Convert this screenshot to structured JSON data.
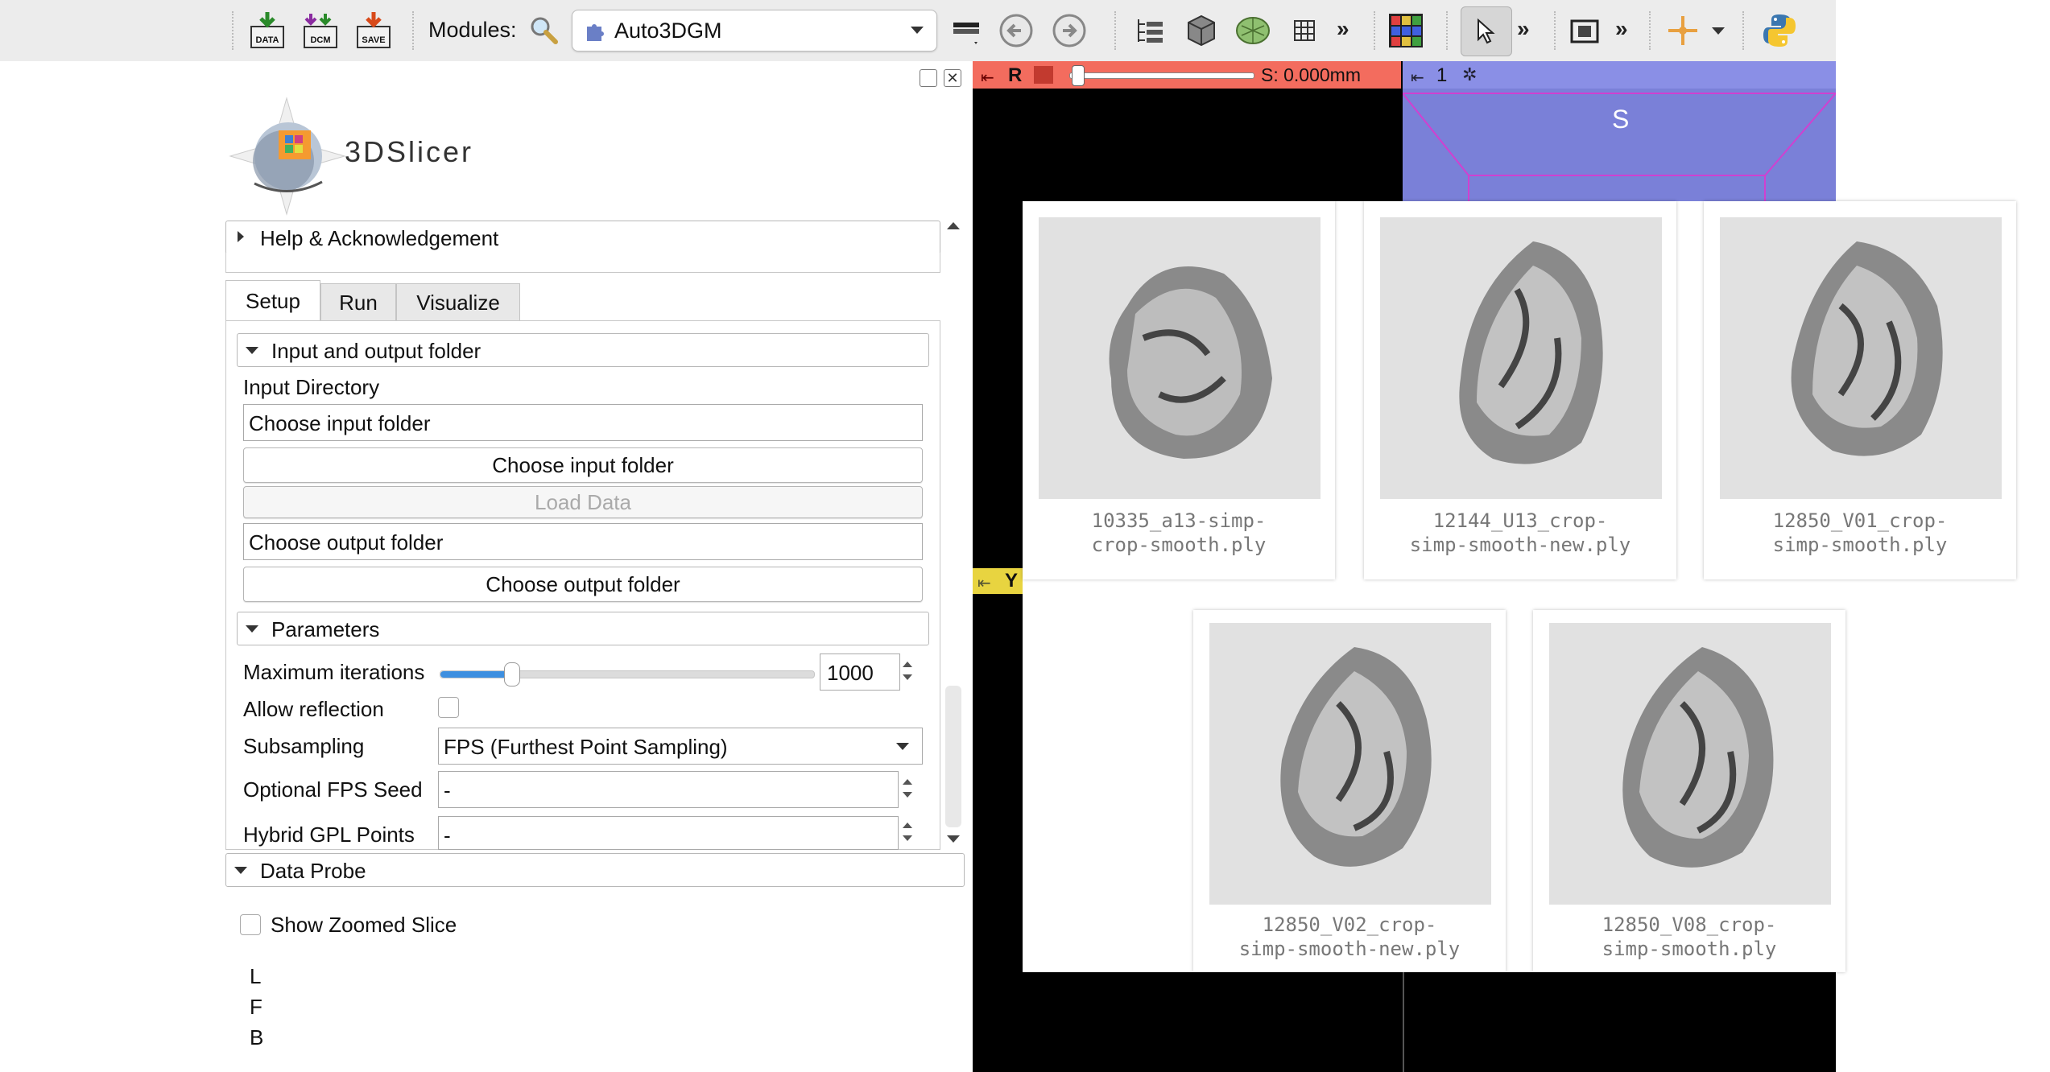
{
  "toolbar": {
    "data_label": "DATA",
    "dcm_label": "DCM",
    "save_label": "SAVE",
    "modules_label": "Modules:",
    "module_selected": "Auto3DGM",
    "more_glyph": "»"
  },
  "panel": {
    "logo_text": "3DSlicer",
    "help_section": "Help & Acknowledgement",
    "tabs": [
      {
        "label": "Setup"
      },
      {
        "label": "Run"
      },
      {
        "label": "Visualize"
      }
    ],
    "io_section": "Input and output folder",
    "input_directory_label": "Input Directory",
    "input_folder_value": "Choose input folder",
    "choose_input_button": "Choose input folder",
    "load_data_button": "Load Data",
    "output_folder_value": "Choose output folder",
    "choose_output_button": "Choose output folder",
    "parameters_section": "Parameters",
    "max_iterations_label": "Maximum iterations",
    "max_iterations_value": "1000",
    "max_iterations_slider_fraction": 0.19,
    "allow_reflection_label": "Allow reflection",
    "subsampling_label": "Subsampling",
    "subsampling_value": "FPS (Furthest Point Sampling)",
    "fps_seed_label": "Optional FPS Seed",
    "fps_seed_value": "-",
    "hybrid_gpl_label": "Hybrid GPL Points",
    "hybrid_gpl_value": "-",
    "data_probe_section": "Data Probe",
    "show_zoomed_slice_label": "Show Zoomed Slice",
    "probe_lines": [
      "L",
      "F",
      "B"
    ]
  },
  "viewers": {
    "red_letter": "R",
    "red_offset": "S: 0.000mm",
    "blue_number": "1",
    "blue_orientation": "S",
    "yellow_letter": "Y"
  },
  "gallery": {
    "files": [
      {
        "line1": "10335_a13-simp-",
        "line2": "crop-smooth.ply"
      },
      {
        "line1": "12144_U13_crop-",
        "line2": "simp-smooth-new.ply"
      },
      {
        "line1": "12850_V01_crop-",
        "line2": "simp-smooth.ply"
      },
      {
        "line1": "12850_V02_crop-",
        "line2": "simp-smooth-new.ply"
      },
      {
        "line1": "12850_V08_crop-",
        "line2": "simp-smooth.ply"
      }
    ]
  },
  "colors": {
    "red_view": "#f36c5e",
    "blue_view": "#8a8fe6",
    "yellow_view": "#e8d440",
    "accent": "#3d8fe0"
  }
}
